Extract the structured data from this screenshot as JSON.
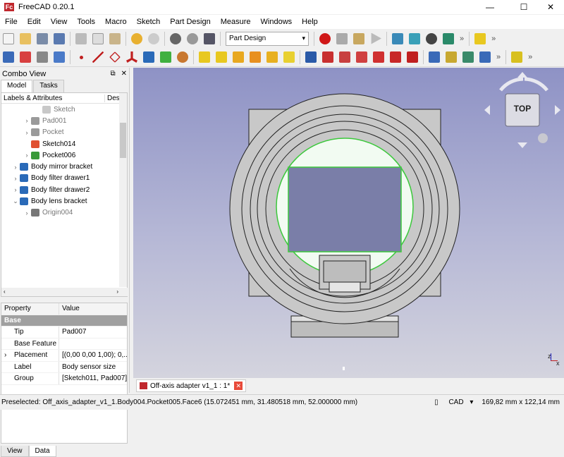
{
  "window": {
    "title": "FreeCAD 0.20.1",
    "logo": "Fc"
  },
  "menu": [
    "File",
    "Edit",
    "View",
    "Tools",
    "Macro",
    "Sketch",
    "Part Design",
    "Measure",
    "Windows",
    "Help"
  ],
  "toolbar": {
    "workbench": "Part Design",
    "more": "»"
  },
  "combo": {
    "title": "Combo View",
    "tabs": [
      "Model",
      "Tasks"
    ],
    "tree_columns": [
      "Labels & Attributes",
      "Des"
    ],
    "tree": [
      {
        "label": "Sketch",
        "depth": 3,
        "arrow": "",
        "icon": "sketch-icon",
        "color": "#c8c8c8",
        "dim": true
      },
      {
        "label": "Pad001",
        "depth": 2,
        "arrow": "›",
        "icon": "pad-icon",
        "color": "#9a9a9a",
        "dim": true
      },
      {
        "label": "Pocket",
        "depth": 2,
        "arrow": "›",
        "icon": "pocket-icon",
        "color": "#9a9a9a",
        "dim": true
      },
      {
        "label": "Sketch014",
        "depth": 2,
        "arrow": "",
        "icon": "sketch-icon",
        "color": "#e05030",
        "dim": false
      },
      {
        "label": "Pocket006",
        "depth": 2,
        "arrow": "›",
        "icon": "pocket-icon",
        "color": "#3a9a3a",
        "dim": false
      },
      {
        "label": "Body mirror bracket",
        "depth": 1,
        "arrow": "›",
        "icon": "body-icon",
        "color": "#2a6ab8",
        "dim": false
      },
      {
        "label": "Body filter drawer1",
        "depth": 1,
        "arrow": "›",
        "icon": "body-icon",
        "color": "#2a6ab8",
        "dim": false
      },
      {
        "label": "Body filter drawer2",
        "depth": 1,
        "arrow": "›",
        "icon": "body-icon",
        "color": "#2a6ab8",
        "dim": false
      },
      {
        "label": "Body lens bracket",
        "depth": 1,
        "arrow": "⌄",
        "icon": "body-icon",
        "color": "#2a6ab8",
        "dim": false
      },
      {
        "label": "Origin004",
        "depth": 2,
        "arrow": "›",
        "icon": "origin-icon",
        "color": "#777777",
        "dim": true
      }
    ],
    "property_columns": [
      "Property",
      "Value"
    ],
    "property_group": "Base",
    "properties": [
      {
        "key": "Tip",
        "value": "Pad007",
        "expand": ""
      },
      {
        "key": "Base Feature",
        "value": "",
        "expand": ""
      },
      {
        "key": "Placement",
        "value": "[(0,00 0,00 1,00); 0,...",
        "expand": "›"
      },
      {
        "key": "Label",
        "value": "Body sensor size",
        "expand": ""
      },
      {
        "key": "Group",
        "value": "[Sketch011, Pad007]",
        "expand": ""
      }
    ],
    "bottom_tabs": [
      "View",
      "Data"
    ]
  },
  "navcube": {
    "face": "TOP"
  },
  "document_tab": {
    "label": "Off-axis adapter v1_1 : 1*"
  },
  "status": {
    "message": "Preselected: Off_axis_adapter_v1_1.Body004.Pocket005.Face6 (15.072451 mm, 31.480518 mm, 52.000000 mm)",
    "nav_style": "CAD",
    "dimensions": "169,82 mm x 122,14 mm"
  },
  "axis": {
    "x": "x",
    "z": "z"
  },
  "colors": {
    "highlight": "#3cc83c",
    "face_fill": "#f2fbf2",
    "part_gray": "#c8c8c8",
    "edge": "#222222"
  }
}
